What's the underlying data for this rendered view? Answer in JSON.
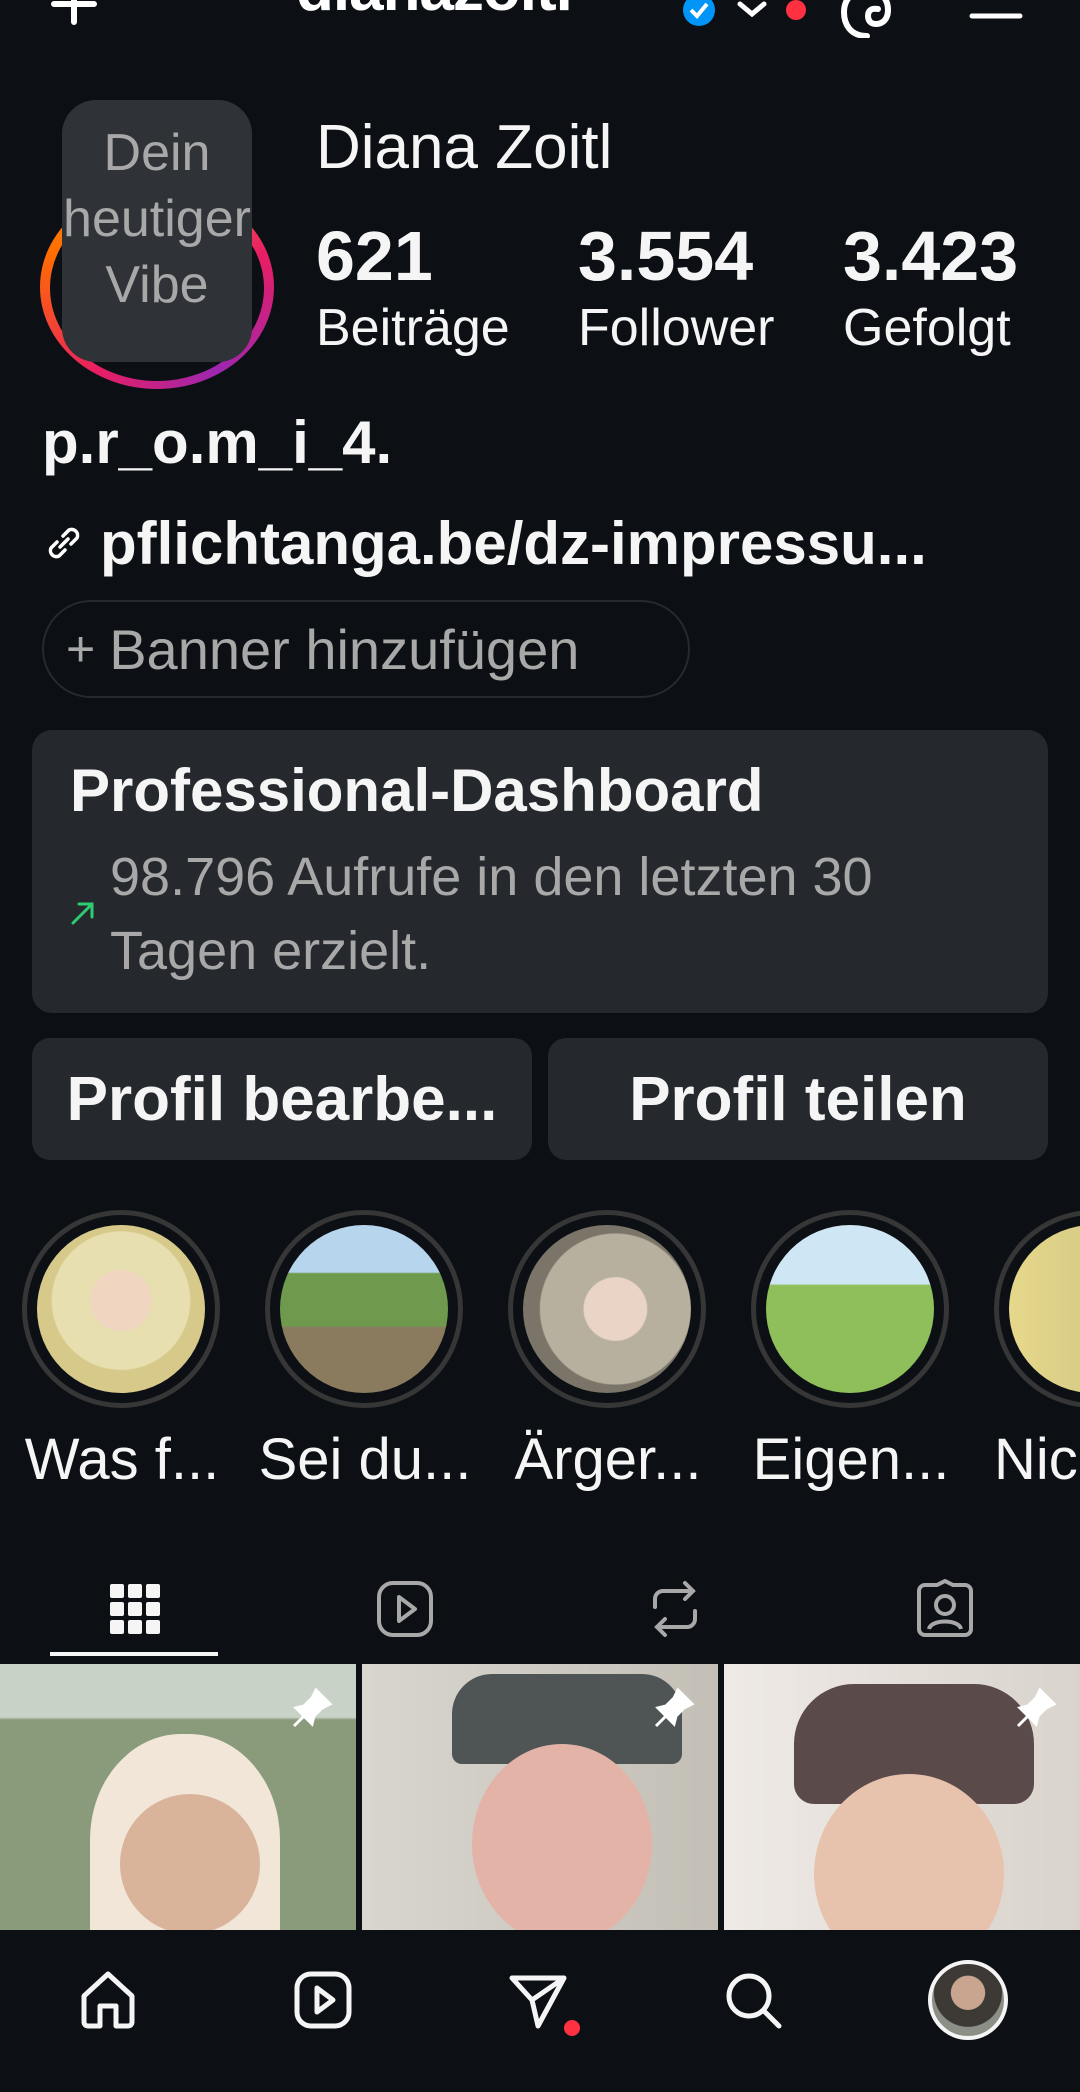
{
  "header": {
    "username": "dianazoitl",
    "icons": [
      "plus-icon",
      "verified-badge-icon",
      "chevron-down-icon",
      "notification-dot",
      "threads-icon",
      "menu-icon"
    ]
  },
  "profile": {
    "note": "Dein heutiger Vibe",
    "display_name": "Diana Zoitl",
    "stats": [
      {
        "value": "621",
        "label": "Beiträge"
      },
      {
        "value": "3.554",
        "label": "Follower"
      },
      {
        "value": "3.423",
        "label": "Gefolgt"
      }
    ],
    "category": "p.r_o.m_i_4.",
    "link": "pflichtanga.be/dz-impressu...",
    "banner_button": "Banner hinzufügen"
  },
  "dashboard": {
    "title": "Professional-Dashboard",
    "subtitle": "98.796 Aufrufe in den letzten 30 Tagen erzielt."
  },
  "actions": {
    "edit_profile": "Profil bearbe...",
    "share_profile": "Profil teilen"
  },
  "highlights": [
    {
      "label": "Was f..."
    },
    {
      "label": "Sei du..."
    },
    {
      "label": "Ärger..."
    },
    {
      "label": "Eigen..."
    },
    {
      "label": "Nic"
    }
  ],
  "tabs": [
    "grid-icon",
    "reels-icon",
    "reposts-icon",
    "tagged-icon"
  ],
  "bottom_nav": [
    "home-icon",
    "reels-icon",
    "direct-icon",
    "search-icon",
    "profile-avatar"
  ],
  "colors": {
    "background": "#0c1014",
    "card": "#25292e",
    "muted_text": "#a8a8a8",
    "verified_blue": "#0095f6",
    "notification_red": "#ff3040",
    "trend_green": "#2ecc71"
  }
}
